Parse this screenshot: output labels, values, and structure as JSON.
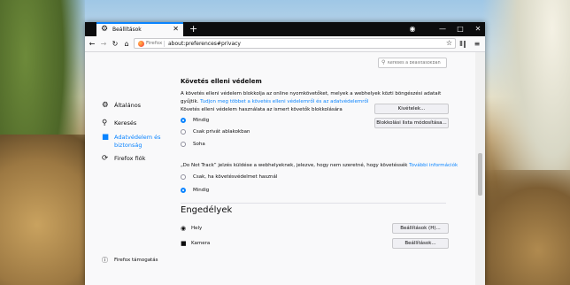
{
  "window": {
    "tab_title": "Beállítások",
    "url": "about:preferences#privacy",
    "firefox_label": "Firefox"
  },
  "icons": {
    "tab": "gear-icon",
    "tab_close": "close-icon",
    "new_tab": "plus-icon",
    "back": "back-arrow-icon",
    "forward": "forward-arrow-icon",
    "reload": "reload-icon",
    "home": "home-icon",
    "bookmark": "star-icon",
    "library": "library-icon",
    "menu": "hamburger-menu-icon",
    "mask": "mask-icon",
    "minimize": "minimize-icon",
    "maximize": "maximize-icon",
    "close": "close-icon",
    "search": "search-icon"
  },
  "sidebar": {
    "items": [
      {
        "label": "Általános",
        "icon": "gear-icon"
      },
      {
        "label": "Keresés",
        "icon": "search-icon"
      },
      {
        "label": "Adatvédelem és",
        "label2": "biztonság",
        "icon": "lock-icon",
        "active": true
      },
      {
        "label": "Firefox fiók",
        "icon": "sync-icon"
      }
    ],
    "support": "Firefox támogatás"
  },
  "search": {
    "placeholder": "Keresés a beállításokban"
  },
  "tracking": {
    "heading": "Követés elleni védelem",
    "desc1": "A követés elleni védelem blokkolja az online nyomkövetőket, melyek a webhelyek közti böngészési adatait",
    "desc2": "gyűjtik.",
    "learn_more": "Tudjon meg többet a követés elleni védelemről és az adatvédelemről",
    "use_label": "Követés elleni védelem használata az ismert követők blokkolására",
    "options": [
      "Mindig",
      "Csak privát ablakokban",
      "Soha"
    ],
    "exceptions_btn": "Kivételek...",
    "blocklist_btn": "Blokkolási lista módosítása..."
  },
  "dnt": {
    "label": "„Do Not Track” jelzés küldése a webhelyeknek, jelezve, hogy nem szeretné, hogy követéssék",
    "more_info": "További információk",
    "options": [
      "Csak, ha követésvédelmet használ",
      "Mindig"
    ]
  },
  "permissions": {
    "heading": "Engedélyek",
    "items": [
      {
        "label": "Hely",
        "icon": "location-icon",
        "button": "Beállítások (H)..."
      },
      {
        "label": "Kamera",
        "icon": "camera-icon",
        "button": "Beállítások..."
      }
    ]
  },
  "colors": {
    "accent": "#0a84ff",
    "tabbar": "#0c0c0d",
    "page": "#f9f9fa"
  }
}
